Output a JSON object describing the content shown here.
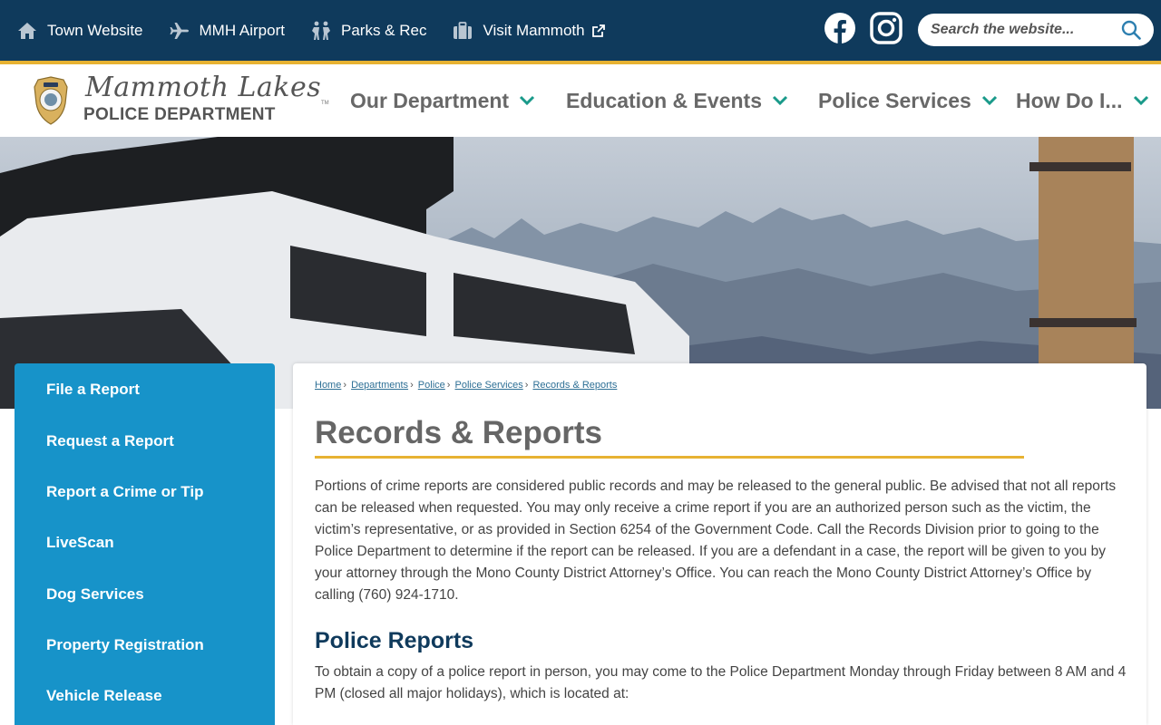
{
  "topbar": {
    "links": [
      {
        "label": "Town Website",
        "icon": "home-icon"
      },
      {
        "label": "MMH Airport",
        "icon": "airplane-icon"
      },
      {
        "label": "Parks & Rec",
        "icon": "people-icon"
      },
      {
        "label": "Visit Mammoth",
        "icon": "suitcase-icon"
      }
    ],
    "social": [
      "facebook-icon",
      "instagram-icon"
    ],
    "search_placeholder": "Search the website...",
    "colors": {
      "bar": "#0f3a5c",
      "accent": "#e7b232"
    }
  },
  "header": {
    "logo_script": "Mammoth Lakes",
    "logo_sub": "POLICE DEPARTMENT",
    "logo_tm": "TM",
    "nav": [
      {
        "label": "Our Department"
      },
      {
        "label": "Education & Events"
      },
      {
        "label": "Police Services"
      },
      {
        "label": "How Do I..."
      }
    ],
    "colors": {
      "nav_text": "#686868",
      "chevron": "#1a9a8a"
    }
  },
  "sidebar": {
    "items": [
      {
        "label": "File a Report"
      },
      {
        "label": "Request a Report"
      },
      {
        "label": "Report a Crime or Tip"
      },
      {
        "label": "LiveScan"
      },
      {
        "label": "Dog Services"
      },
      {
        "label": "Property Registration"
      },
      {
        "label": "Vehicle Release"
      }
    ],
    "color": "#1793c9"
  },
  "main": {
    "breadcrumb": [
      "Home",
      "Departments",
      "Police",
      "Police Services",
      "Records & Reports"
    ],
    "title": "Records & Reports",
    "intro": "Portions of crime reports are considered public records and may be released to the general public. Be advised that not all reports can be released when requested. You may only receive a crime report if you are an authorized person such as the victim, the victim’s representative, or as provided in Section 6254 of the Government Code. Call the Records Division prior to going to the Police Department to determine if the report can be released. If you are a defendant in a case, the report will be given to you by your attorney through the Mono County District Attorney’s Office. You can reach the Mono County District Attorney’s Office by calling (760) 924-1710.",
    "section_heading": "Police Reports",
    "section_text": "To obtain a copy of a police report in person, you may come to the Police Department Monday through Friday between 8 AM and 4 PM (closed all major holidays), which is located at:"
  }
}
